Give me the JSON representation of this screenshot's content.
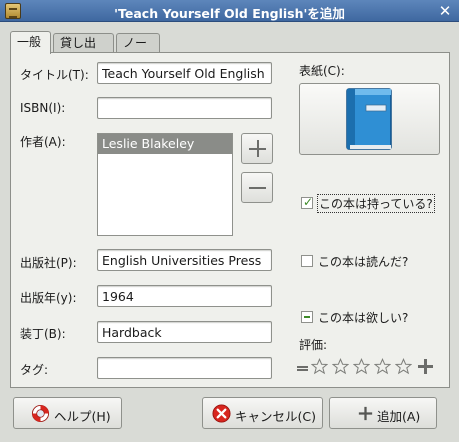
{
  "window": {
    "title": "'Teach Yourself Old English'を追加",
    "close_glyph": "✕"
  },
  "tabs": [
    {
      "label": "一般",
      "active": true
    },
    {
      "label": "貸し出し",
      "active": false
    },
    {
      "label": "ノート",
      "active": false
    }
  ],
  "form": {
    "title_label": "タイトル(T):",
    "title_value": "Teach Yourself Old English",
    "isbn_label": "ISBN(I):",
    "isbn_value": "",
    "author_label": "作者(A):",
    "authors": [
      "Leslie Blakeley"
    ],
    "publisher_label": "出版社(P):",
    "publisher_value": "English Universities Press",
    "year_label": "出版年(y):",
    "year_value": "1964",
    "binding_label": "装丁(B):",
    "binding_value": "Hardback",
    "tags_label": "タグ:",
    "tags_value": ""
  },
  "cover": {
    "label": "表紙(C):",
    "icon": "blue-book-icon"
  },
  "checks": {
    "own_label": "この本は持っている?",
    "own_state": "checked",
    "read_label": "この本は読んだ?",
    "read_state": "unchecked",
    "want_label": "この本は欲しい?",
    "want_state": "indeterminate"
  },
  "rating": {
    "label": "評価:",
    "value": 0,
    "max": 5
  },
  "buttons": {
    "help_label": "ヘルプ(H)",
    "cancel_label": "キャンセル(C)",
    "add_label": "追加(A)"
  },
  "colors": {
    "titlebar": "#4a74ab",
    "selection": "#8a8c88",
    "book_blue": "#2f8fd4",
    "check_green": "#3e8a28",
    "cancel_red": "#d8261f"
  }
}
